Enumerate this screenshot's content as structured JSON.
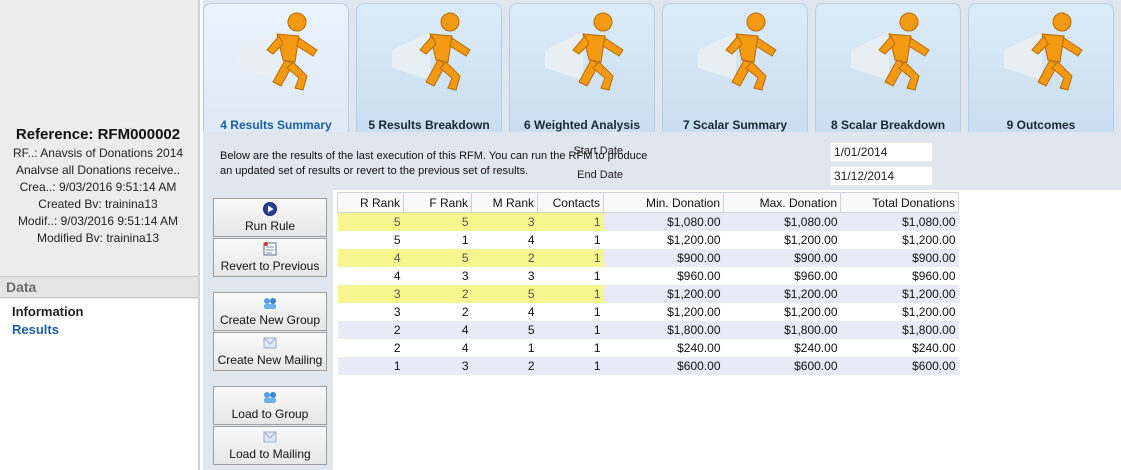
{
  "reference": {
    "title": "Reference: RFM000002",
    "rfm_line": "RF..: Anavsis of Donations 2014",
    "analyse_line": "Analvse all Donations receive..",
    "created_line": "Crea..: 9/03/2016 9:51:14 AM",
    "created_by_line": "Created Bv: trainina13",
    "modified_line": "Modif..: 9/03/2016 9:51:14 AM",
    "modified_by_line": "Modified Bv: trainina13",
    "dots": ". ."
  },
  "data_panel": {
    "header": "Data",
    "items": [
      {
        "label": "Information"
      },
      {
        "label": "Results"
      }
    ]
  },
  "tabs": [
    {
      "label": "4 Results Summary",
      "active": true
    },
    {
      "label": "5 Results Breakdown",
      "active": false
    },
    {
      "label": "6 Weighted Analysis",
      "active": false
    },
    {
      "label": "7 Scalar Summary",
      "active": false
    },
    {
      "label": "8 Scalar Breakdown",
      "active": false
    },
    {
      "label": "9 Outcomes",
      "active": false
    }
  ],
  "info": {
    "line1": "Below are the results of the last execution of this RFM. You can run the RFM to produce",
    "line2": "an updated set of results or revert to the previous set of results.",
    "start_date_label": "Start Date",
    "start_date": "1/01/2014",
    "end_date_label": "End Date",
    "end_date": "31/12/2014"
  },
  "actions": {
    "run_rule": "Run Rule",
    "revert": "Revert to Previous",
    "create_group": "Create New Group",
    "create_mailing": "Create New Mailing",
    "load_group": "Load to Group",
    "load_mailing": "Load to Mailing"
  },
  "colors": {
    "accent": "#1d5fa8",
    "highlight": "#f6f68e",
    "row_alt": "#eaeaf7",
    "runner_orange": "#f39a12"
  },
  "table": {
    "headers": [
      "R Rank",
      "F Rank",
      "M Rank",
      "Contacts",
      "Min. Donation",
      "Max. Donation",
      "Total Donations"
    ],
    "rows": [
      {
        "cells": [
          "5",
          "5",
          "3",
          "1",
          "$1,080.00",
          "$1,080.00",
          "$1,080.00"
        ],
        "highlight": true
      },
      {
        "cells": [
          "5",
          "1",
          "4",
          "1",
          "$1,200.00",
          "$1,200.00",
          "$1,200.00"
        ],
        "highlight": false
      },
      {
        "cells": [
          "4",
          "5",
          "2",
          "1",
          "$900.00",
          "$900.00",
          "$900.00"
        ],
        "highlight": true
      },
      {
        "cells": [
          "4",
          "3",
          "3",
          "1",
          "$960.00",
          "$960.00",
          "$960.00"
        ],
        "highlight": false
      },
      {
        "cells": [
          "3",
          "2",
          "5",
          "1",
          "$1,200.00",
          "$1,200.00",
          "$1,200.00"
        ],
        "highlight": true
      },
      {
        "cells": [
          "3",
          "2",
          "4",
          "1",
          "$1,200.00",
          "$1,200.00",
          "$1,200.00"
        ],
        "highlight": false
      },
      {
        "cells": [
          "2",
          "4",
          "5",
          "1",
          "$1,800.00",
          "$1,800.00",
          "$1,800.00"
        ],
        "highlight": false
      },
      {
        "cells": [
          "2",
          "4",
          "1",
          "1",
          "$240.00",
          "$240.00",
          "$240.00"
        ],
        "highlight": false
      },
      {
        "cells": [
          "1",
          "3",
          "2",
          "1",
          "$600.00",
          "$600.00",
          "$600.00"
        ],
        "highlight": false
      }
    ]
  }
}
